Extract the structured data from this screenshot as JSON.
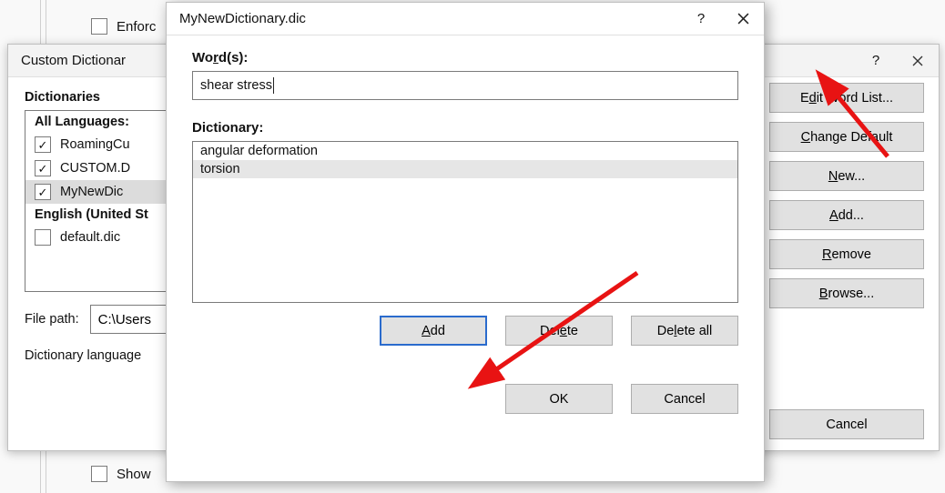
{
  "bg": {
    "enforce_label": "Enforc",
    "show_label": "Show"
  },
  "custom_dict_dialog": {
    "title": "Custom Dictionar",
    "dict_list_label": "Dictionaries",
    "groups": {
      "all_languages_label": "All Languages:",
      "english_us_label": "English (United St"
    },
    "items": {
      "roaming": "RoamingCu",
      "custom": "CUSTOM.D",
      "mynew": "MyNewDic",
      "default": "default.dic"
    },
    "file_path_label": "File path:",
    "file_path_value": "C:\\Users",
    "dict_lang_label": "Dictionary language",
    "buttons": {
      "edit_word_list": "Edit Word List...",
      "change_default": "Change Default",
      "new": "New...",
      "add": "Add...",
      "remove": "Remove",
      "browse": "Browse...",
      "cancel": "Cancel"
    }
  },
  "edit_dialog": {
    "title": "MyNewDictionary.dic",
    "words_label": "Word(s):",
    "word_input": "shear stress",
    "dictionary_label": "Dictionary:",
    "entries": [
      "angular deformation",
      "torsion"
    ],
    "buttons": {
      "add": "Add",
      "delete": "Delete",
      "delete_all": "Delete all",
      "ok": "OK",
      "cancel": "Cancel"
    }
  }
}
